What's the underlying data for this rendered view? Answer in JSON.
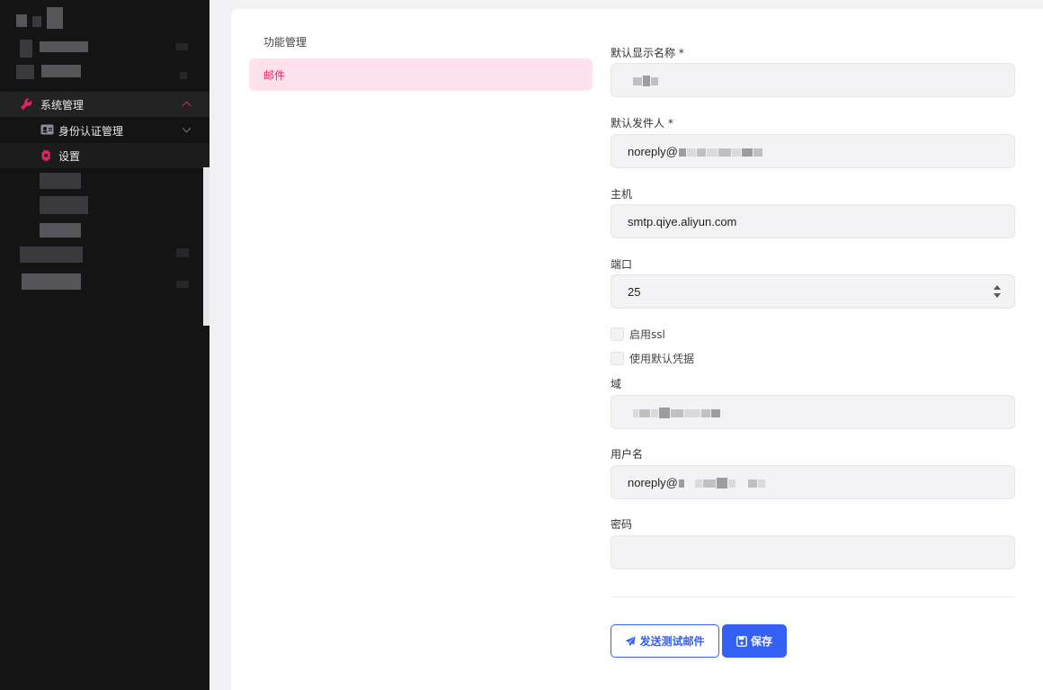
{
  "colors": {
    "accent": "#e02563",
    "primary": "#3560f5",
    "sidebar_bg": "#141414"
  },
  "sidebar": {
    "active_group": {
      "label": "系统管理",
      "icon": "wrench-icon"
    },
    "sub_items": [
      {
        "label": "身份认证管理",
        "icon": "id-card-icon"
      },
      {
        "label": "设置",
        "icon": "gear-icon"
      }
    ]
  },
  "settings_menu": {
    "title": "功能管理",
    "active_item": "邮件"
  },
  "form": {
    "display_name": {
      "label": "默认显示名称 *",
      "value": ""
    },
    "sender": {
      "label": "默认发件人 *",
      "value": "noreply@"
    },
    "host": {
      "label": "主机",
      "value": "smtp.qiye.aliyun.com"
    },
    "port": {
      "label": "端口",
      "value": "25"
    },
    "enable_ssl": {
      "label": "启用ssl",
      "checked": false
    },
    "use_default_credentials": {
      "label": "使用默认凭据",
      "checked": false
    },
    "domain": {
      "label": "域",
      "value": ""
    },
    "username": {
      "label": "用户名",
      "value": "noreply@"
    },
    "password": {
      "label": "密码",
      "value": ""
    }
  },
  "actions": {
    "send_test_label": "发送测试邮件",
    "save_label": "保存"
  }
}
